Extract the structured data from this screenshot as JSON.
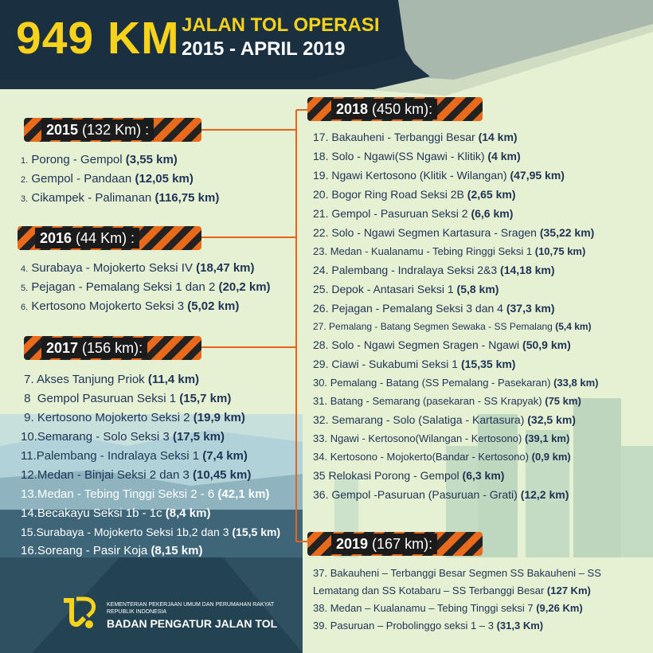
{
  "header": {
    "big_number": "949 KM",
    "title": "JALAN TOL OPERASI",
    "period": "2015 - APRIL 2019"
  },
  "sections": {
    "y2015": {
      "year": "2015",
      "total": " (132 Km) :"
    },
    "y2016": {
      "year": "2016",
      "total": " (44 Km) :"
    },
    "y2017": {
      "year": "2017",
      "total": " (156 km):"
    },
    "y2018": {
      "year": "2018",
      "total": " (450 km):"
    },
    "y2019": {
      "year": "2019",
      "total": " (167 km):"
    }
  },
  "items": [
    {
      "num": "1.",
      "name": "Porong - Gempol",
      "length": "(3,55 km)"
    },
    {
      "num": "2.",
      "name": "Gempol - Pandaan",
      "length": "(12,05 km)"
    },
    {
      "num": "3.",
      "name": "Cikampek - Palimanan",
      "length": "(116,75 km)"
    },
    {
      "num": "4.",
      "name": "Surabaya - Mojokerto Seksi IV",
      "length": "(18,47 km)"
    },
    {
      "num": "5.",
      "name": "Pejagan - Pemalang Seksi 1 dan 2",
      "length": "(20,2 km)"
    },
    {
      "num": "6.",
      "name": "Kertosono Mojokerto Seksi 3",
      "length": "(5,02 km)"
    },
    {
      "num": "7.",
      "name": "Akses Tanjung Priok",
      "length": "(11,4 km)"
    },
    {
      "num": "8",
      "name": "Gempol Pasuruan Seksi 1",
      "length": "(15,7 km)"
    },
    {
      "num": "9.",
      "name": "Kertosono Mojokerto Seksi 2",
      "length": "(19,9 km)"
    },
    {
      "num": "10.",
      "name": "Semarang - Solo Seksi 3",
      "length": "(17,5 km)"
    },
    {
      "num": "11.",
      "name": "Palembang - Indralaya Seksi 1",
      "length": "(7,4 km)"
    },
    {
      "num": "12.",
      "name": "Medan - Binjai Seksi 2 dan 3",
      "length": "(10,45 km)"
    },
    {
      "num": "13.",
      "name": "Medan - Tebing Tinggi Seksi 2 - 6",
      "length": "(42,1 km)"
    },
    {
      "num": "14.",
      "name": "Becakayu Seksi 1b - 1c",
      "length": "(8,4 km)"
    },
    {
      "num": "15.",
      "name": "Surabaya - Mojokerto Seksi 1b,2 dan 3",
      "length": "(15,5 km)"
    },
    {
      "num": "16.",
      "name": "Soreang - Pasir Koja",
      "length": "(8,15 km)"
    },
    {
      "num": "17.",
      "name": "Bakauheni - Terbanggi Besar",
      "length": "(14 km)"
    },
    {
      "num": "18.",
      "name": "Solo - Ngawi(SS Ngawi - Klitik)",
      "length": "(4 km)"
    },
    {
      "num": "19.",
      "name": "Ngawi Kertosono (Klitik - Wilangan)",
      "length": "(47,95 km)"
    },
    {
      "num": "20.",
      "name": "Bogor Ring Road Seksi 2B",
      "length": "(2,65 km)"
    },
    {
      "num": "21.",
      "name": "Gempol - Pasuruan Seksi 2",
      "length": "(6,6 km)"
    },
    {
      "num": "22.",
      "name": "Solo - Ngawi Segmen Kartasura - Sragen",
      "length": "(35,22 km)"
    },
    {
      "num": "23.",
      "name": "Medan - Kualanamu - Tebing Ringgi Seksi 1",
      "length": "(10,75 km)"
    },
    {
      "num": "24.",
      "name": "Palembang - Indralaya Seksi 2&3",
      "length": "(14,18 km)"
    },
    {
      "num": "25.",
      "name": "Depok - Antasari Seksi 1",
      "length": "(5,8 km)"
    },
    {
      "num": "26.",
      "name": "Pejagan - Pemalang Seksi 3 dan 4",
      "length": "(37,3 km)"
    },
    {
      "num": "27.",
      "name": "Pemalang - Batang Segmen Sewaka - SS Pemalang",
      "length": "(5,4 km)"
    },
    {
      "num": "28.",
      "name": "Solo - Ngawi Segmen Sragen - Ngawi",
      "length": "(50,9 km)"
    },
    {
      "num": "29.",
      "name": "Ciawi - Sukabumi Seksi 1",
      "length": "(15,35 km)"
    },
    {
      "num": "30.",
      "name": "Pemalang - Batang (SS Pemalang - Pasekaran)",
      "length": "(33,8 km)"
    },
    {
      "num": "31.",
      "name": "Batang - Semarang (pasekaran - SS Krapyak)",
      "length": "(75 km)"
    },
    {
      "num": "32.",
      "name": "Semarang - Solo (Salatiga - Kartasura)",
      "length": "(32,5 km)"
    },
    {
      "num": "33.",
      "name": "Ngawi - Kertosono(Wilangan - Kertosono)",
      "length": "(39,1 km)"
    },
    {
      "num": "34.",
      "name": "Kertosono - Mojokerto(Bandar - Kertosono)",
      "length": "(0,9 km)"
    },
    {
      "num": "35",
      "name": "Relokasi Porong - Gempol",
      "length": "(6,3 km)"
    },
    {
      "num": "36.",
      "name": "Gempol -Pasuruan (Pasuruan - Grati)",
      "length": "(12,2 km)"
    },
    {
      "num": "37.",
      "name": "Bakauheni – Terbanggi Besar Segmen SS Bakauheni – SS",
      "length": ""
    },
    {
      "num": "",
      "name": "Lematang dan SS Kotabaru – SS Terbanggi Besar",
      "length": "(127 Km)"
    },
    {
      "num": "38.",
      "name": "Medan – Kualanamu – Tebing Tinggi seksi 7",
      "length": "(9,26 Km)"
    },
    {
      "num": "39.",
      "name": "Pasuruan – Probolinggo seksi 1 – 3",
      "length": "(31,3 Km)"
    }
  ],
  "footer": {
    "ministry": "KEMENTERIAN PEKERJAAN UMUM DAN PERUMAHAN RAKYAT",
    "republic": "REPUBLIK INDONESIA",
    "agency": "BADAN PENGATUR JALAN TOL"
  },
  "colors": {
    "header_bg": "#1d3344",
    "banner_yellow": "#f6d21a",
    "stripe_orange": "#e86a1a",
    "connector": "#e8631a",
    "text_navy": "#1f3354",
    "page_bg": "#e6f1d4"
  },
  "icons": [
    "road-logo-icon",
    "city-skyline-illustration",
    "highway-illustration"
  ]
}
